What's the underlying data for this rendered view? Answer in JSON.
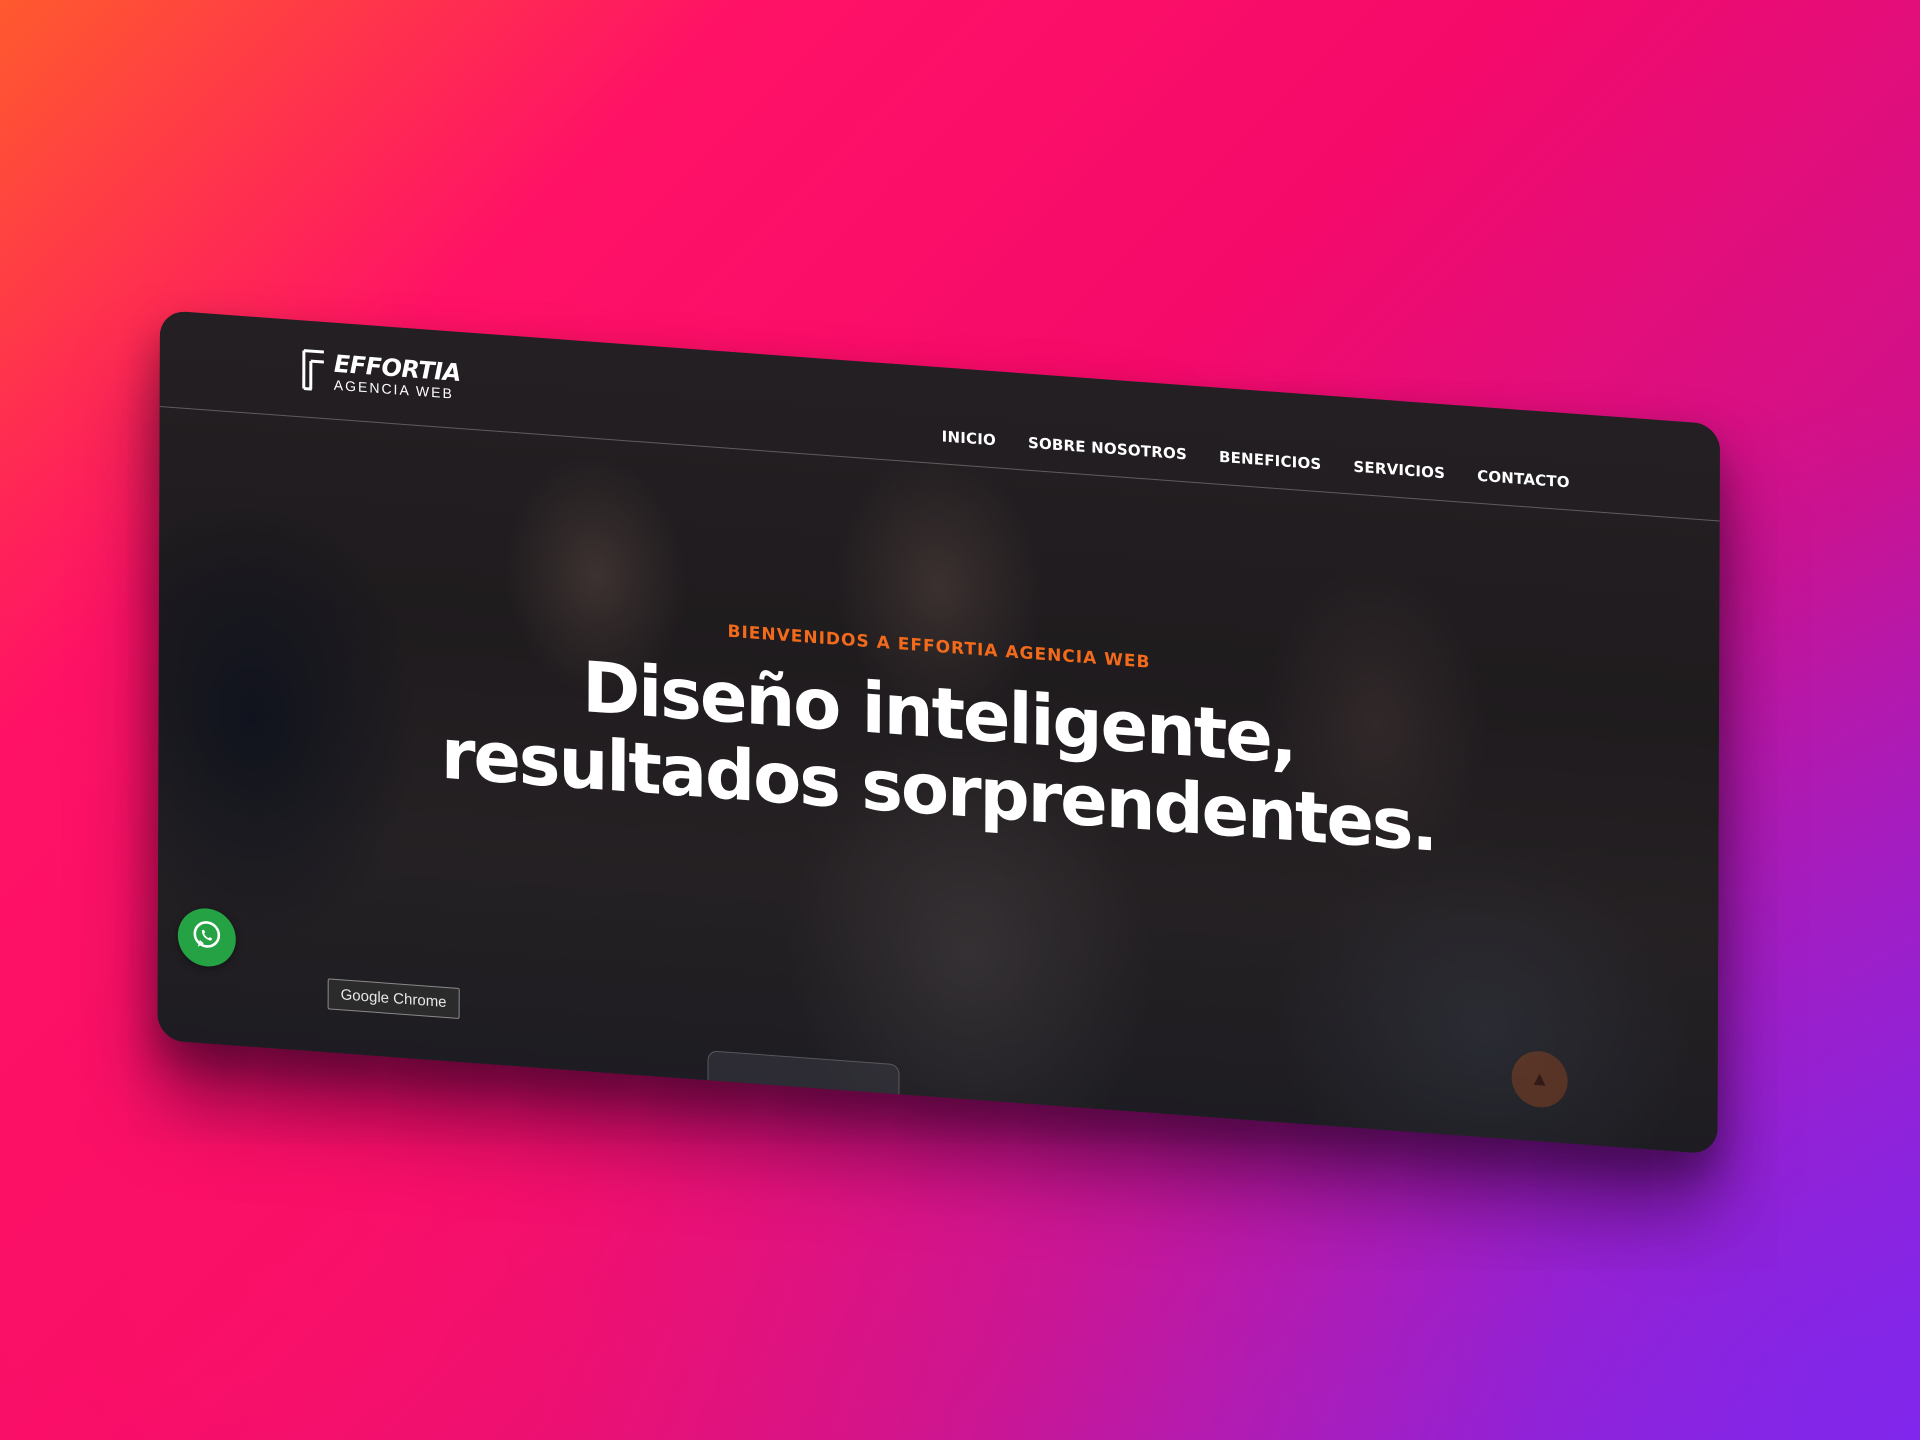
{
  "brand": {
    "name": "EFFORTIA",
    "tagline": "AGENCIA WEB"
  },
  "nav": {
    "items": [
      {
        "label": "INICIO"
      },
      {
        "label": "SOBRE NOSOTROS"
      },
      {
        "label": "BENEFICIOS"
      },
      {
        "label": "SERVICIOS"
      },
      {
        "label": "CONTACTO"
      }
    ]
  },
  "hero": {
    "eyebrow": "BIENVENIDOS A EFFORTIA AGENCIA WEB",
    "headline_line1": "Diseño inteligente,",
    "headline_line2": "resultados sorprendentes."
  },
  "tooltip": {
    "text": "Google Chrome"
  },
  "icons": {
    "whatsapp": "whatsapp-icon",
    "scroll_top": "arrow-up-icon"
  },
  "colors": {
    "accent": "#f26a1b",
    "whatsapp": "#25a244"
  }
}
